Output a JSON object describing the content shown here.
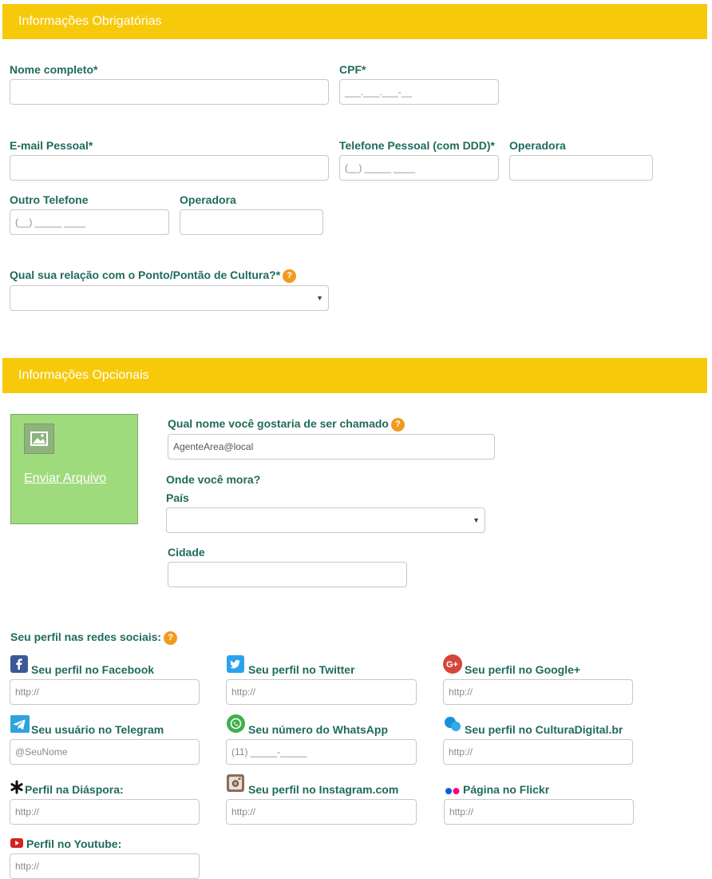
{
  "sections": {
    "required": "Informações Obrigatórias",
    "optional": "Informações Opcionais"
  },
  "required": {
    "nome": {
      "label": "Nome completo*",
      "value": ""
    },
    "cpf": {
      "label": "CPF*",
      "placeholder": "___.___.___-__"
    },
    "email": {
      "label": "E-mail Pessoal*",
      "value": ""
    },
    "telefone": {
      "label": "Telefone Pessoal (com DDD)*",
      "placeholder": "(__) _____ ____"
    },
    "operadora1": {
      "label": "Operadora",
      "value": ""
    },
    "outro_telefone": {
      "label": "Outro Telefone",
      "placeholder": "(__) _____ ____"
    },
    "operadora2": {
      "label": "Operadora",
      "value": ""
    },
    "relacao": {
      "label": "Qual sua relação com o Ponto/Pontão de Cultura?*",
      "value": ""
    }
  },
  "help_glyph": "?",
  "select_arrow": "▼",
  "optional": {
    "upload": {
      "link": "Enviar Arquivo"
    },
    "apelido": {
      "label": "Qual nome você gostaria de ser chamado",
      "value": "AgenteArea@local"
    },
    "onde_mora": "Onde você mora?",
    "pais": {
      "label": "País",
      "value": ""
    },
    "cidade": {
      "label": "Cidade",
      "value": ""
    }
  },
  "social": {
    "title": "Seu perfil nas redes sociais:",
    "items": [
      {
        "label": "Seu perfil no Facebook",
        "placeholder": "http://",
        "icon": "facebook-icon"
      },
      {
        "label": "Seu perfil no Twitter",
        "placeholder": "http://",
        "icon": "twitter-icon"
      },
      {
        "label": "Seu perfil no Google+",
        "placeholder": "http://",
        "icon": "google-plus-icon"
      },
      {
        "label": "Seu usuário no Telegram",
        "placeholder": "@SeuNome",
        "icon": "telegram-icon"
      },
      {
        "label": "Seu número do WhatsApp",
        "placeholder": "(11) _____-_____",
        "icon": "whatsapp-icon"
      },
      {
        "label": "Seu perfil no CulturaDigital.br",
        "placeholder": "http://",
        "icon": "culturadigital-icon"
      },
      {
        "label": "Perfil na Diáspora:",
        "placeholder": "http://",
        "icon": "diaspora-icon"
      },
      {
        "label": "Seu perfil no Instagram.com",
        "placeholder": "http://",
        "icon": "instagram-icon"
      },
      {
        "label": "Página no Flickr",
        "placeholder": "http://",
        "icon": "flickr-icon"
      },
      {
        "label": "Perfil no Youtube:",
        "placeholder": "http://",
        "icon": "youtube-icon"
      }
    ]
  },
  "colors": {
    "header_bar": "#f6c90b",
    "label_text": "#1f6b5c",
    "help_badge": "#f29a1e",
    "upload_bg": "#9fdb7c"
  }
}
